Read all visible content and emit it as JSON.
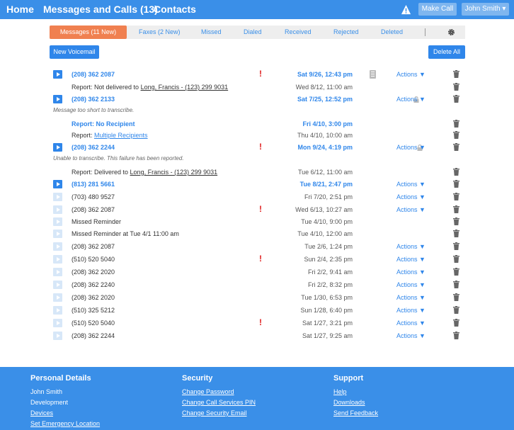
{
  "nav": {
    "home": "Home",
    "messages": "Messages and Calls (13)",
    "contacts": "Contacts",
    "make_call": "Make Call",
    "user": "John Smith ▾"
  },
  "tabs": [
    {
      "label": "Messages (11 New)",
      "active": true
    },
    {
      "label": "Faxes (2 New)"
    },
    {
      "label": "Missed"
    },
    {
      "label": "Dialed"
    },
    {
      "label": "Received"
    },
    {
      "label": "Rejected"
    },
    {
      "label": "Deleted"
    }
  ],
  "buttons": {
    "new_voicemail": "New Voicemail",
    "delete_all": "Delete All"
  },
  "actions_label": "Actions ▼",
  "rows": [
    {
      "label": "(208) 362 2087",
      "date": "Sat 9/26, 12:43 pm"
    },
    {
      "label_prefix": "Report: Not delivered to ",
      "label_link": "Long, Francis - (123) 299 9031",
      "date": "Wed 8/12, 11:00 am"
    },
    {
      "label": "(208) 362 2133",
      "date": "Sat 7/25, 12:52 pm"
    },
    {
      "label": "Report: No Recipient",
      "date": "Fri 4/10, 3:00 pm"
    },
    {
      "label_prefix": "Report: ",
      "label_link": "Multiple Recipients",
      "date": "Thu 4/10, 10:00 am"
    },
    {
      "label": "(208) 362 2244",
      "date": "Mon 9/24, 4:19 pm"
    },
    {
      "label_prefix": "Report: Delivered to ",
      "label_link": "Long, Francis - (123) 299 9031",
      "date": "Tue 6/12, 11:00 am"
    },
    {
      "label": "(813) 281 5661",
      "date": "Tue 8/21, 2:47 pm"
    },
    {
      "label": "(703) 480 9527",
      "date": "Fri 7/20, 2:51 pm"
    },
    {
      "label": "(208) 362 2087",
      "date": "Wed 6/13, 10:27 am"
    },
    {
      "label": "Missed Reminder",
      "date": "Tue 4/10, 9:00 pm"
    },
    {
      "label": "Missed Reminder at Tue 4/1 11:00 am",
      "date": "Tue 4/10, 12:00 am"
    },
    {
      "label": "(208) 362 2087",
      "date": "Tue 2/6, 1:24 pm"
    },
    {
      "label": "(510) 520 5040",
      "date": "Sun 2/4, 2:35 pm"
    },
    {
      "label": "(208) 362 2020",
      "date": "Fri 2/2, 9:41 am"
    },
    {
      "label": "(208) 362 2240",
      "date": "Fri 2/2, 8:32 pm"
    },
    {
      "label": "(208) 362 2020",
      "date": "Tue 1/30, 6:53 pm"
    },
    {
      "label": "(510) 325 5212",
      "date": "Sun 1/28, 6:40 pm"
    },
    {
      "label": "(510) 520 5040",
      "date": "Sat 1/27, 3:21 pm"
    },
    {
      "label": "(208) 362 2244",
      "date": "Sat 1/27, 9:25 am"
    }
  ],
  "notes": {
    "short": "Message too short to transcribe.",
    "failed": "Unable to transcribe. This failure has been reported."
  },
  "footer": {
    "personal": {
      "title": "Personal Details",
      "items": [
        "John Smith",
        "Development",
        "Devices",
        "Set Emergency Location"
      ]
    },
    "security": {
      "title": "Security",
      "items": [
        "Change Password",
        "Change Call Services PIN",
        "Change Security Email"
      ]
    },
    "support": {
      "title": "Support",
      "items": [
        "Help",
        "Downloads",
        "Send Feedback"
      ]
    }
  },
  "colors": {
    "brand_blue": "#3a8fe8",
    "active_tab": "#f08050",
    "alert": "#e02020"
  }
}
